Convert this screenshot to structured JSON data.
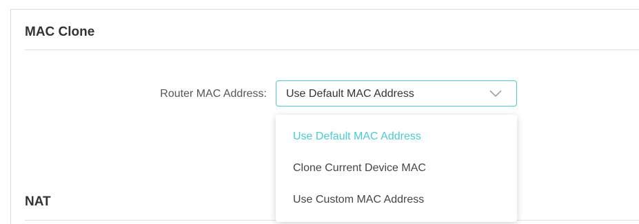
{
  "mac_clone": {
    "title": "MAC Clone",
    "router_mac_label": "Router MAC Address:",
    "selected_value": "Use Default MAC Address",
    "options": [
      "Use Default MAC Address",
      "Clone Current Device MAC",
      "Use Custom MAC Address"
    ]
  },
  "nat": {
    "title": "NAT"
  },
  "colors": {
    "accent": "#4acbd6",
    "text": "#333333",
    "muted": "#555555"
  },
  "icons": {
    "dropdown": "chevron-down-icon"
  }
}
